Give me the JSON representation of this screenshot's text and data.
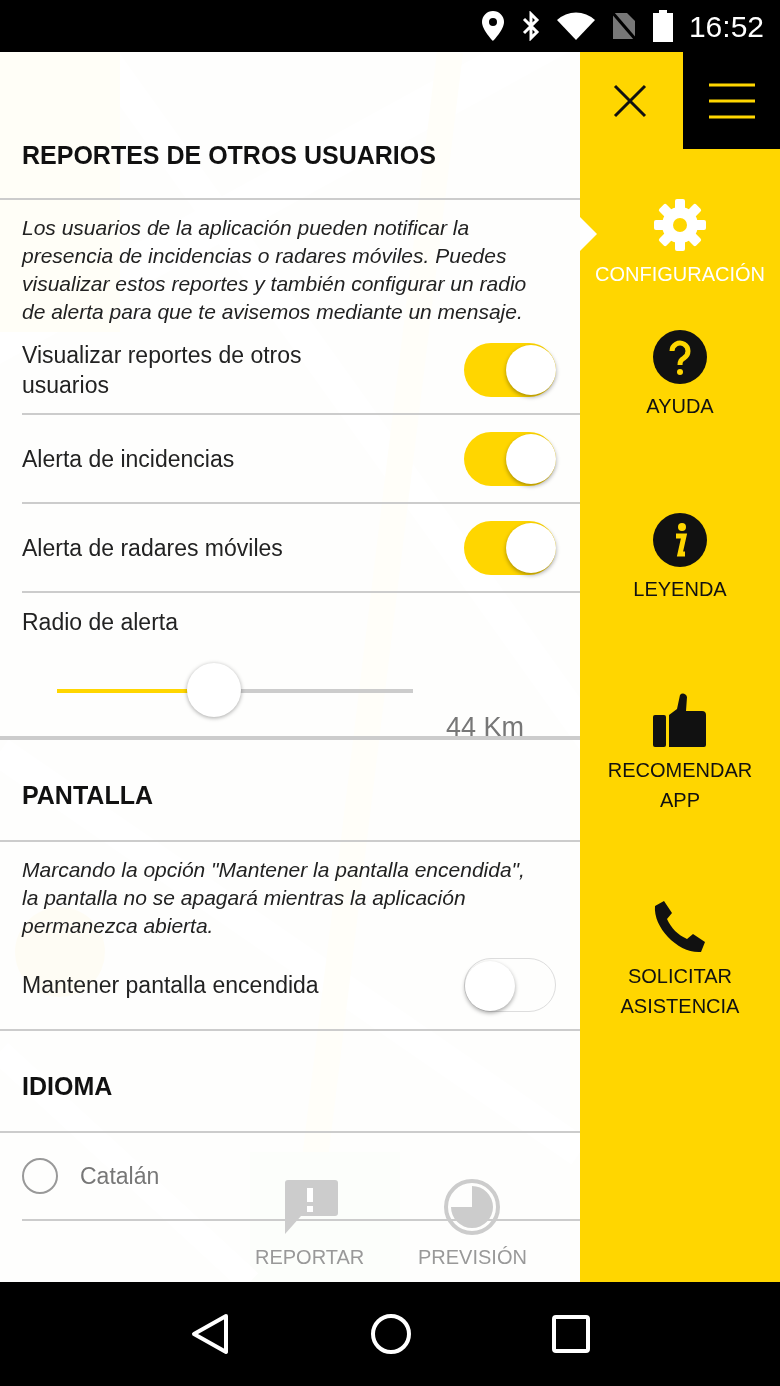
{
  "status_bar": {
    "time": "16:52"
  },
  "sections": [
    {
      "title": "REPORTES DE OTROS USUARIOS",
      "description": "Los usuarios de la aplicación pueden notificar la presencia de incidencias o radares móviles. Puedes visualizar estos reportes y también configurar un radio de alerta para que te avisemos mediante un mensaje.",
      "settings": [
        {
          "kind": "switch",
          "label": "Visualizar reportes de otros usuarios",
          "on": true
        },
        {
          "kind": "switch",
          "label": "Alerta de incidencias",
          "on": true
        },
        {
          "kind": "switch",
          "label": "Alerta de radares móviles",
          "on": true
        },
        {
          "kind": "slider",
          "label": "Radio de alerta",
          "level": 0.44,
          "reading": "44 Km"
        }
      ]
    },
    {
      "title": "PANTALLA",
      "description": "Marcando la opción \"Mantener la pantalla encendida\", la pantalla no se apagará mientras la aplicación permanezca abierta.",
      "settings": [
        {
          "kind": "switch",
          "label": "Mantener pantalla encendida",
          "on": false
        }
      ]
    },
    {
      "title": "IDIOMA",
      "settings": [
        {
          "kind": "radio",
          "label": "Catalán",
          "selected": false
        }
      ]
    }
  ],
  "background_buttons": [
    {
      "kind": "report",
      "label": "REPORTAR"
    },
    {
      "kind": "forecast",
      "label": "PREVISIÓN"
    }
  ],
  "sidebar": {
    "items": [
      {
        "kind": "settings",
        "label": "CONFIGURACIÓN",
        "selected": true
      },
      {
        "kind": "help",
        "label": "AYUDA",
        "selected": false
      },
      {
        "kind": "legend",
        "label": "LEYENDA",
        "selected": false
      },
      {
        "kind": "recommend",
        "label": "RECOMENDAR APP",
        "selected": false
      },
      {
        "kind": "assist",
        "label": "SOLICITAR ASISTENCIA",
        "selected": false
      }
    ]
  }
}
